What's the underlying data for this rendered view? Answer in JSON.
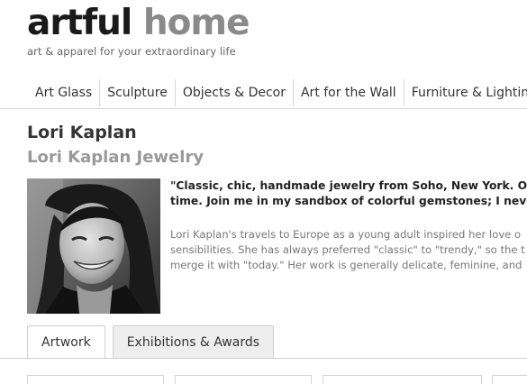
{
  "brand": {
    "name_dark": "artful",
    "name_light": "home",
    "tagline": "art & apparel for your extraordinary life"
  },
  "nav": {
    "items": [
      {
        "label": "Art Glass"
      },
      {
        "label": "Sculpture"
      },
      {
        "label": "Objects & Decor"
      },
      {
        "label": "Art for the Wall"
      },
      {
        "label": "Furniture & Lighting"
      }
    ]
  },
  "artist": {
    "name": "Lori Kaplan",
    "studio": "Lori Kaplan Jewelry"
  },
  "bio": {
    "quote_lines": [
      "\"Classic, chic, handmade jewelry from Soho, New York. One",
      "time. Join me in my sandbox of colorful gemstones; I never t"
    ],
    "body_lines": [
      "Lori Kaplan's travels to Europe as a young adult inspired her love o",
      "sensibilities. She has always preferred \"classic\" to \"trendy,\" so the t",
      "merge it with \"today.\" Her work is generally delicate, feminine, and"
    ]
  },
  "tabs": [
    {
      "label": "Artwork",
      "active": true
    },
    {
      "label": "Exhibitions & Awards",
      "active": false
    }
  ],
  "colors": {
    "logo_dark": "#1a1a1a",
    "logo_light": "#8a8a8a",
    "muted_text": "#999999",
    "rule": "#d6d6d6",
    "tab_inactive_bg": "#eeeeee"
  }
}
